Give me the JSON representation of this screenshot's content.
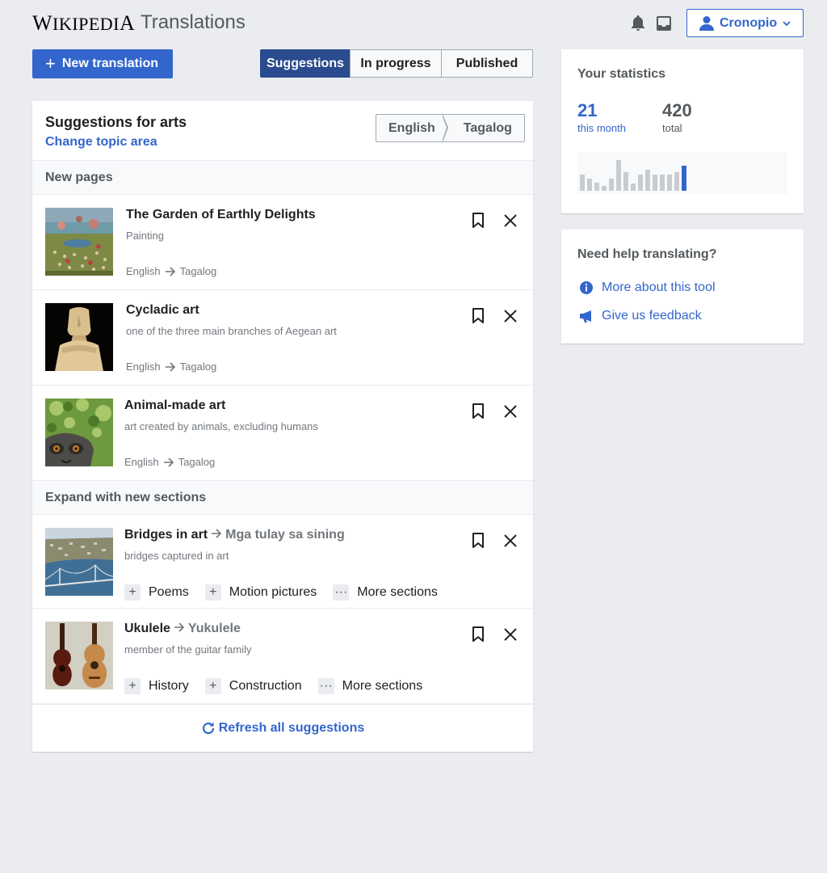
{
  "header": {
    "wordmark": "Wikipedia",
    "app_title": "Translations",
    "notifications_icon": "bell-icon",
    "inbox_icon": "tray-icon",
    "user_label": "Cronopio"
  },
  "toolbar": {
    "new_translation_label": "New translation",
    "tabs": [
      {
        "label": "Suggestions",
        "active": true
      },
      {
        "label": "In progress",
        "active": false
      },
      {
        "label": "Published",
        "active": false
      }
    ]
  },
  "suggestions": {
    "title": "Suggestions for arts",
    "change_topic_label": "Change topic area",
    "source_language": "English",
    "target_language": "Tagalog",
    "new_pages_heading": "New pages",
    "new_pages": [
      {
        "title": "The Garden of Earthly Delights",
        "description": "Painting",
        "from": "English",
        "to": "Tagalog"
      },
      {
        "title": "Cycladic art",
        "description": "one of the three main branches of Aegean art",
        "from": "English",
        "to": "Tagalog"
      },
      {
        "title": "Animal-made art",
        "description": "art created by animals, excluding humans",
        "from": "English",
        "to": "Tagalog"
      }
    ],
    "sections_heading": "Expand with new sections",
    "section_items": [
      {
        "title": "Bridges in art",
        "target_title": "Mga tulay sa sining",
        "description": "bridges captured in art",
        "sections": [
          "Poems",
          "Motion pictures"
        ],
        "more_label": "More sections"
      },
      {
        "title": "Ukulele",
        "target_title": "Yukulele",
        "description": "member of the guitar family",
        "sections": [
          "History",
          "Construction"
        ],
        "more_label": "More sections"
      }
    ],
    "refresh_label": "Refresh all suggestions"
  },
  "stats": {
    "title": "Your statistics",
    "month_value": "21",
    "month_label": "this month",
    "total_value": "420",
    "total_label": "total",
    "monthly_counts": [
      14,
      10,
      7,
      4,
      10,
      26,
      16,
      6,
      14,
      18,
      14,
      14,
      14,
      16,
      21
    ],
    "accent_color": "#3366cc"
  },
  "help": {
    "title": "Need help translating?",
    "links": [
      {
        "label": "More about this tool",
        "icon": "info-icon"
      },
      {
        "label": "Give us feedback",
        "icon": "megaphone-icon"
      }
    ]
  }
}
